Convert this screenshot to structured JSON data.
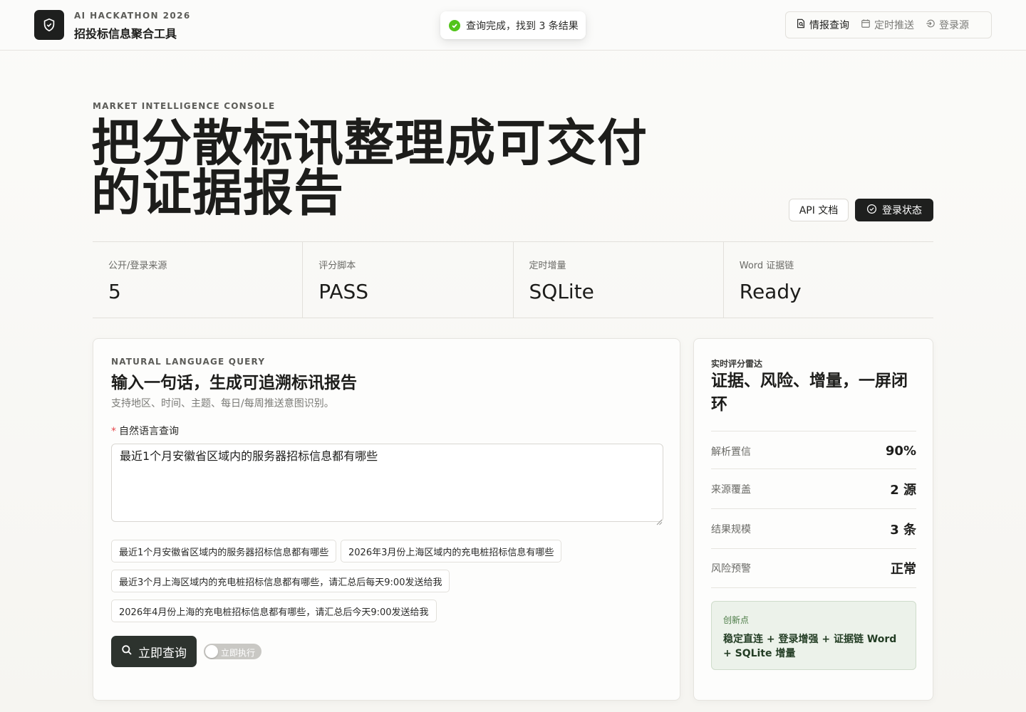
{
  "header": {
    "kicker": "AI HACKATHON 2026",
    "title": "招投标信息聚合工具",
    "nav": [
      {
        "label": "情报查询",
        "icon": "search-doc-icon",
        "active": true
      },
      {
        "label": "定时推送",
        "icon": "calendar-icon",
        "active": false
      },
      {
        "label": "登录源",
        "icon": "login-icon",
        "active": false
      }
    ]
  },
  "toast": {
    "text": "查询完成，找到 3 条结果",
    "icon": "success-check-icon",
    "color": "#52c41a"
  },
  "hero": {
    "kicker": "MARKET INTELLIGENCE CONSOLE",
    "title_line1": "把分散标讯整理成可交付",
    "title_line2": "的证据报告",
    "api_button": "API 文档",
    "login_status_button": "登录状态"
  },
  "stats": [
    {
      "label": "公开/登录来源",
      "value": "5"
    },
    {
      "label": "评分脚本",
      "value": "PASS"
    },
    {
      "label": "定时增量",
      "value": "SQLite"
    },
    {
      "label": "Word 证据链",
      "value": "Ready"
    }
  ],
  "query": {
    "kicker": "NATURAL LANGUAGE QUERY",
    "title": "输入一句话，生成可追溯标讯报告",
    "subtitle": "支持地区、时间、主题、每日/每周推送意图识别。",
    "field_label": "自然语言查询",
    "required_mark": "*",
    "value": "最近1个月安徽省区域内的服务器招标信息都有哪些",
    "examples": [
      "最近1个月安徽省区域内的服务器招标信息都有哪些",
      "2026年3月份上海区域内的充电桩招标信息有哪些",
      "最近3个月上海区域内的充电桩招标信息都有哪些，请汇总后每天9:00发送给我",
      "2026年4月份上海的充电桩招标信息都有哪些，请汇总后今天9:00发送给我"
    ],
    "search_button": "立即查询",
    "toggle_label": "立即执行",
    "toggle_on": false
  },
  "radar": {
    "kicker": "实时评分雷达",
    "title": "证据、风险、增量，一屏闭环",
    "metrics": [
      {
        "label": "解析置信",
        "value": "90%"
      },
      {
        "label": "来源覆盖",
        "value": "2 源"
      },
      {
        "label": "结果规模",
        "value": "3 条"
      },
      {
        "label": "风险预警",
        "value": "正常"
      }
    ],
    "innovation_kicker": "创新点",
    "innovation_text": "稳定直连 + 登录增强 + 证据链 Word + SQLite 增量"
  },
  "colors": {
    "accent_dark": "#1e1f1e",
    "success": "#52c41a",
    "innovation_bg": "#ecf2ea"
  }
}
